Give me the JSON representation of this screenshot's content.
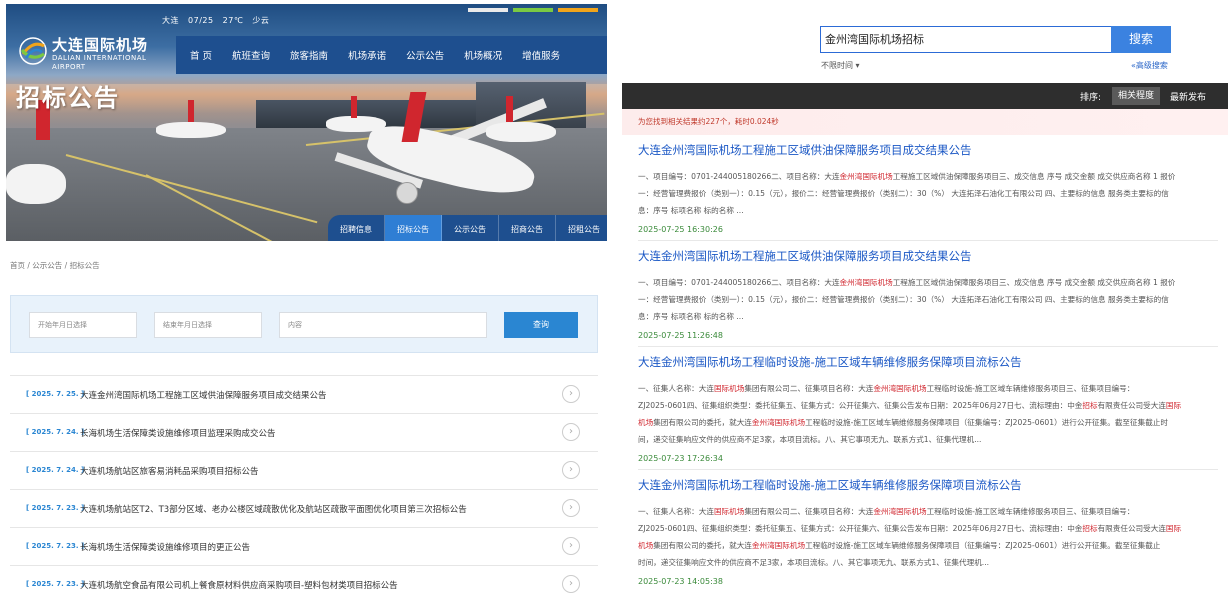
{
  "left": {
    "weather": {
      "city": "大连",
      "date": "07/25",
      "temp": "27℃",
      "cond": "少云"
    },
    "logo": {
      "cn": "大连国际机场",
      "en1": "DALIAN INTERNATIONAL",
      "en2": "AIRPORT"
    },
    "nav": [
      "首 页",
      "航班查询",
      "旅客指南",
      "机场承诺",
      "公示公告",
      "机场概况",
      "增值服务"
    ],
    "page_title": "招标公告",
    "subtabs": [
      "招聘信息",
      "招标公告",
      "公示公告",
      "招商公告",
      "招租公告"
    ],
    "active_subtab": "招标公告",
    "breadcrumb": "首页 / 公示公告 / 招标公告",
    "filter": {
      "start_placeholder": "开始年月日选择",
      "end_placeholder": "结束年月日选择",
      "content_placeholder": "内容",
      "query_label": "查询"
    },
    "list": [
      {
        "date": "[ 2025. 7. 25. ]",
        "title": "大连金州湾国际机场工程施工区域供油保障服务项目成交结果公告"
      },
      {
        "date": "[ 2025. 7. 24. ]",
        "title": "长海机场生活保障类设施维修项目监理采购成交公告"
      },
      {
        "date": "[ 2025. 7. 24. ]",
        "title": "大连机场航站区旅客易消耗品采购项目招标公告"
      },
      {
        "date": "[ 2025. 7. 23. ]",
        "title": "大连机场航站区T2、T3部分区域、老办公楼区域疏散优化及航站区疏散平面图优化项目第三次招标公告"
      },
      {
        "date": "[ 2025. 7. 23. ]",
        "title": "长海机场生活保障类设施维修项目的更正公告"
      },
      {
        "date": "[ 2025. 7. 23. ]",
        "title": "大连机场航空食品有限公司机上餐食原材料供应商采购项目-塑料包材类项目招标公告"
      }
    ],
    "colors": {
      "nav": "#1e4f8f",
      "accent": "#2a86d2"
    }
  },
  "right": {
    "search": {
      "value": "金州湾国际机场招标",
      "button": "搜索"
    },
    "time_filter": "不限时间 ▾",
    "advanced": "«高级搜索",
    "sort": {
      "label": "排序:",
      "opt1": "相关程度",
      "opt2": "最新发布"
    },
    "found": "为您找到相关结果约227个，耗时0.024秒",
    "results": [
      {
        "title": "大连金州湾国际机场工程施工区域供油保障服务项目成交结果公告",
        "desc1a": "一、项目编号：0701-244005180266二、项目名称：大连",
        "desc1hl": "金州湾国际机场",
        "desc1b": "工程施工区域供油保障服务项目三、成交信息 序号 成交金额 成交供应商名称 1 报价",
        "desc2": "一：经营管理费报价（类别一）：0.15（元），报价二：经营管理费报价（类别二）：30（%） 大连拓泽石油化工有限公司 四、主要标的信息 服务类主要标的信",
        "desc3": "息：序号 标项名称 标的名称 ...",
        "time": "2025-07-25 16:30:26"
      },
      {
        "title": "大连金州湾国际机场工程施工区域供油保障服务项目成交结果公告",
        "desc1a": "一、项目编号：0701-244005180266二、项目名称：大连",
        "desc1hl": "金州湾国际机场",
        "desc1b": "工程施工区域供油保障服务项目三、成交信息 序号 成交金额 成交供应商名称 1 报价",
        "desc2": "一：经营管理费报价（类别一）：0.15（元），报价二：经营管理费报价（类别二）：30（%） 大连拓泽石油化工有限公司 四、主要标的信息 服务类主要标的信",
        "desc3": "息：序号 标项名称 标的名称 ...",
        "time": "2025-07-25 11:26:48"
      },
      {
        "title": "大连金州湾国际机场工程临时设施-施工区域车辆维修服务保障项目流标公告",
        "line1a": "一、征集人名称：大连",
        "line1hl": "国际机场",
        "line1b": "集团有限公司二、征集项目名称：大连",
        "line1hl2": "金州湾国际机场",
        "line1c": "工程临时设施-施工区域车辆维修服务项目三、征集项目编号：",
        "line2a": "ZJ2025-0601四、征集组织类型：委托征集五、征集方式：公开征集六、征集公告发布日期：2025年06月27日七、流标理由：中金",
        "line2hl": "招标",
        "line2b": "有限责任公司受大连",
        "line2hl2": "国际",
        "line3a": "机场",
        "line3b": "集团有限公司的委托，就大连",
        "line3hl": "金州湾国际机场",
        "line3c": "工程临时设施-施工区域车辆维修服务保障项目（征集编号：ZJ2025-0601）进行公开征集。截至征集截止时",
        "line4": "间，递交征集响应文件的供应商不足3家，本项目流标。八、其它事项无九、联系方式1、征集代理机...",
        "time": "2025-07-23 17:26:34"
      },
      {
        "title": "大连金州湾国际机场工程临时设施-施工区域车辆维修服务保障项目流标公告",
        "line1a": "一、征集人名称：大连",
        "line1hl": "国际机场",
        "line1b": "集团有限公司二、征集项目名称：大连",
        "line1hl2": "金州湾国际机场",
        "line1c": "工程临时设施-施工区域车辆维修服务项目三、征集项目编号：",
        "line2a": "ZJ2025-0601四、征集组织类型：委托征集五、征集方式：公开征集六、征集公告发布日期：2025年06月27日七、流标理由：中金",
        "line2hl": "招标",
        "line2b": "有限责任公司受大连",
        "line2hl2": "国际",
        "line3a": "机场",
        "line3b": "集团有限公司的委托，就大连",
        "line3hl": "金州湾国际机场",
        "line3c": "工程临时设施-施工区域车辆维修服务保障项目（征集编号：ZJ2025-0601）进行公开征集。截至征集截止",
        "line4": "时间，递交征集响应文件的供应商不足3家，本项目流标。八、其它事项无九、联系方式1、征集代理机...",
        "time": "2025-07-23 14:05:38"
      }
    ],
    "colors": {
      "link": "#1a57c5",
      "highlight": "#d0262e",
      "time": "#3a8a3a",
      "search_button": "#3b82e0"
    }
  }
}
